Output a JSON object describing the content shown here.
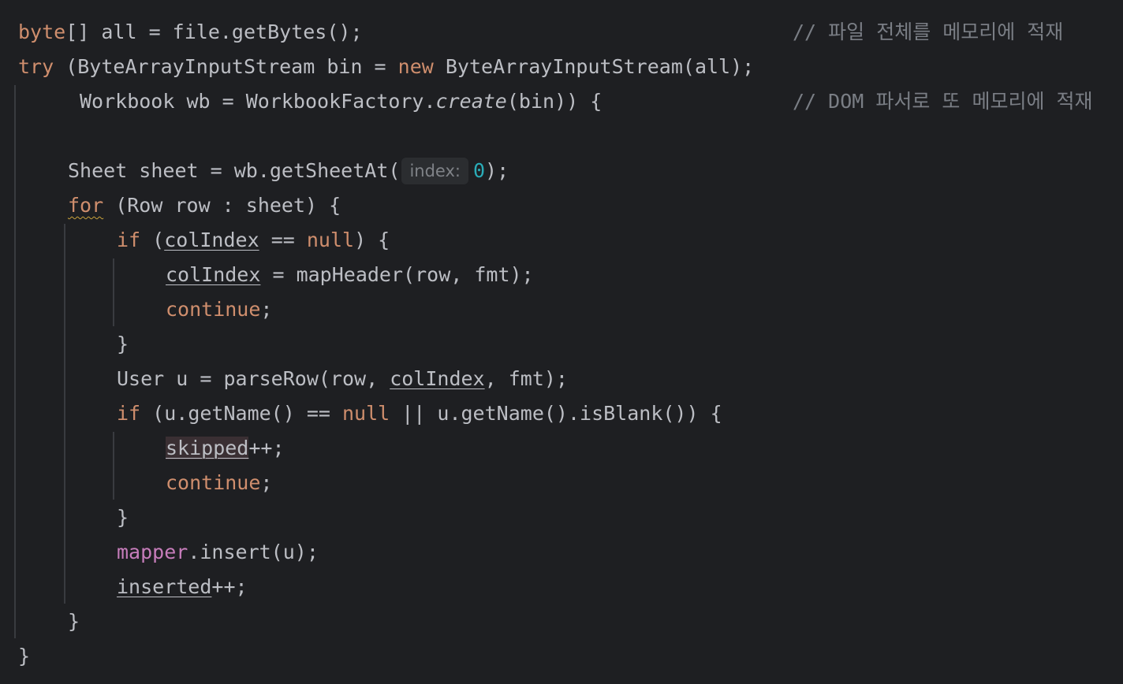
{
  "code": {
    "l1": {
      "kw_byte": "byte",
      "rest": "[] all = file.getBytes();",
      "comment": "// 파일 전체를 메모리에 적재"
    },
    "l2": {
      "kw_try": "try",
      "a": " (ByteArrayInputStream bin = ",
      "kw_new": "new",
      "b": " ByteArrayInputStream(all);"
    },
    "l3": {
      "a": "Workbook wb = WorkbookFactory.",
      "method": "create",
      "b": "(bin)) {",
      "comment": "// DOM 파서로 또 메모리에 적재"
    },
    "l5": {
      "a": "Sheet sheet = wb.getSheetAt(",
      "hint": "index:",
      "num": "0",
      "b": ");"
    },
    "l6": {
      "kw_for": "for",
      "rest": " (Row row : sheet) {"
    },
    "l7": {
      "kw_if": "if",
      "a": " (",
      "var": "colIndex",
      "b": " == ",
      "kw_null": "null",
      "c": ") {"
    },
    "l8": {
      "var": "colIndex",
      "rest": " = mapHeader(row, fmt);"
    },
    "l9": {
      "kw_continue": "continue",
      "semi": ";"
    },
    "l10": {
      "brace": "}"
    },
    "l11": {
      "a": "User u = parseRow(row, ",
      "var": "colIndex",
      "b": ", fmt);"
    },
    "l12": {
      "kw_if": "if",
      "a": " (u.getName() == ",
      "kw_null": "null",
      "b": " || u.getName().isBlank()) {"
    },
    "l13": {
      "var": "skipped",
      "rest": "++;"
    },
    "l14": {
      "kw_continue": "continue",
      "semi": ";"
    },
    "l15": {
      "brace": "}"
    },
    "l16": {
      "field": "mapper",
      "rest": ".insert(u);"
    },
    "l17": {
      "var": "inserted",
      "rest": "++;"
    },
    "l18": {
      "brace": "}"
    },
    "l19": {
      "brace": "}"
    }
  },
  "colors": {
    "background": "#1e1f22",
    "text": "#bcbec4",
    "keyword": "#cf8e6d",
    "field": "#c77dbb",
    "number": "#2aacb8",
    "comment": "#7a7e85",
    "warning": "#c9a23b"
  }
}
